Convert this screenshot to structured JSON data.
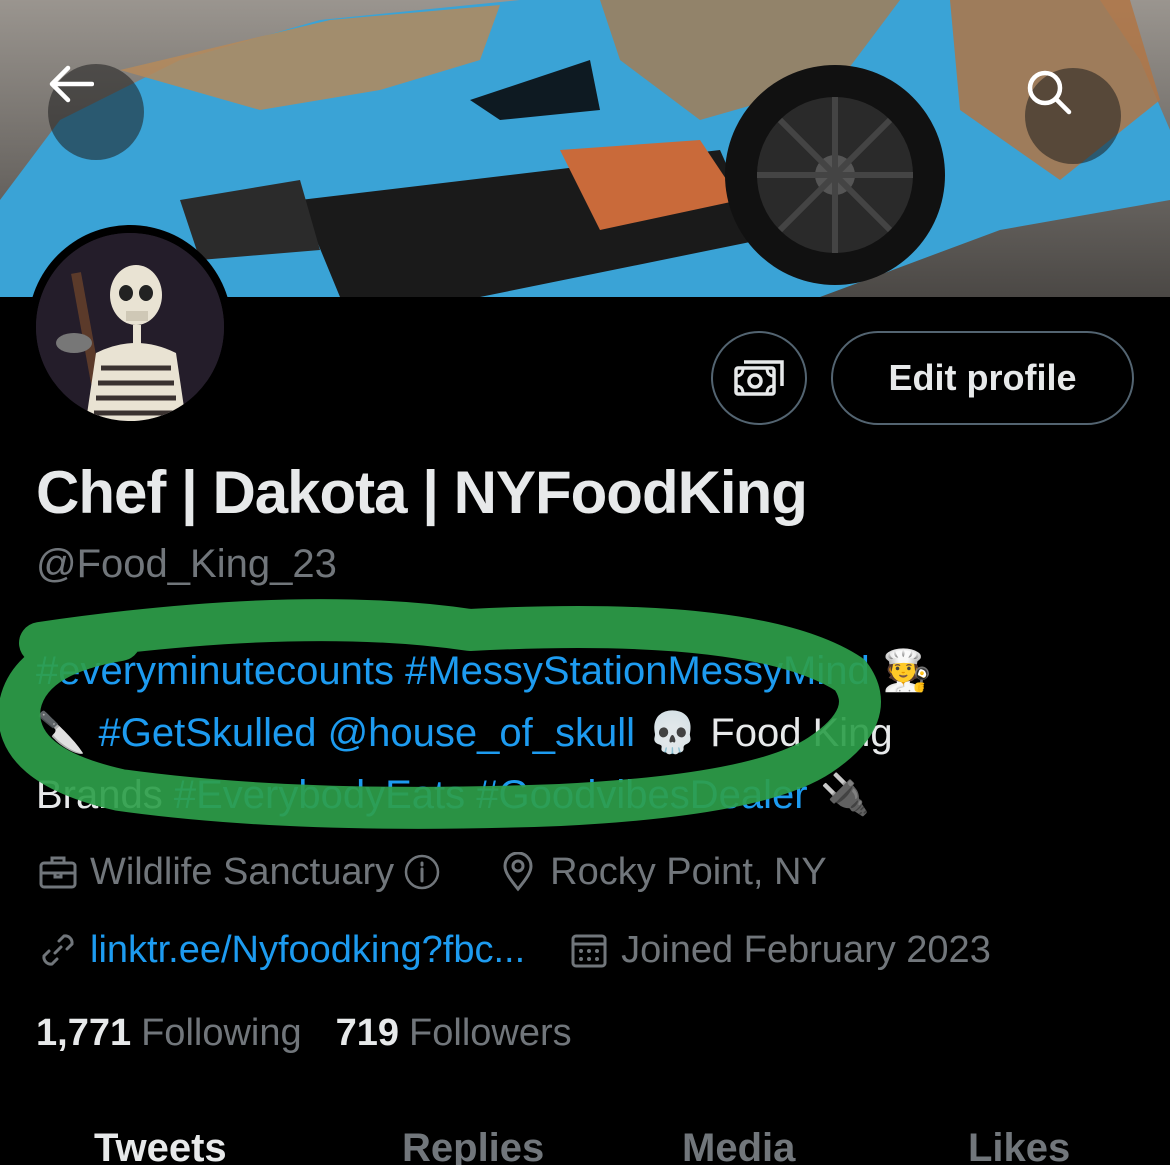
{
  "profile": {
    "display_name": "Chef | Dakota | NYFoodKing",
    "handle": "@Food_King_23",
    "bio": {
      "line1": [
        {
          "text": "#everyminutecounts",
          "type": "tag"
        },
        {
          "text": " ",
          "type": "text"
        },
        {
          "text": "#MessyStationMessyMind",
          "type": "tag"
        },
        {
          "text": " 🧑‍🍳",
          "type": "emoji"
        }
      ],
      "line2": [
        {
          "text": "🔪 ",
          "type": "emoji"
        },
        {
          "text": " #GetSkulled",
          "type": "tag"
        },
        {
          "text": " ",
          "type": "text"
        },
        {
          "text": "@house_of_skull",
          "type": "tag"
        },
        {
          "text": " 💀 ",
          "type": "emoji"
        },
        {
          "text": " Food King",
          "type": "text"
        }
      ],
      "line3": [
        {
          "text": "Brands ",
          "type": "text"
        },
        {
          "text": "#EverybodyEats",
          "type": "tag"
        },
        {
          "text": " ",
          "type": "text"
        },
        {
          "text": "#GoodvibesDealer",
          "type": "tag"
        },
        {
          "text": " 🔌",
          "type": "emoji"
        }
      ]
    },
    "profession": "Wildlife Sanctuary",
    "location": "Rocky Point, NY",
    "website": "linktr.ee/Nyfoodking?fbc...",
    "joined": "Joined February 2023",
    "following_count": "1,771",
    "following_label": "Following",
    "followers_count": "719",
    "followers_label": "Followers"
  },
  "actions": {
    "edit_profile_label": "Edit profile"
  },
  "tabs": [
    "Tweets",
    "Replies",
    "Media",
    "Likes"
  ],
  "icons": {
    "back": "arrow-left-icon",
    "search": "search-icon",
    "tip": "money-icon",
    "profession": "briefcase-icon",
    "info": "info-icon",
    "location": "location-pin-icon",
    "website": "link-icon",
    "joined": "calendar-icon"
  },
  "colors": {
    "accent": "#1d9bf0",
    "muted": "#71767b",
    "text": "#e7e9ea",
    "highlight": "#2e9e4a"
  }
}
